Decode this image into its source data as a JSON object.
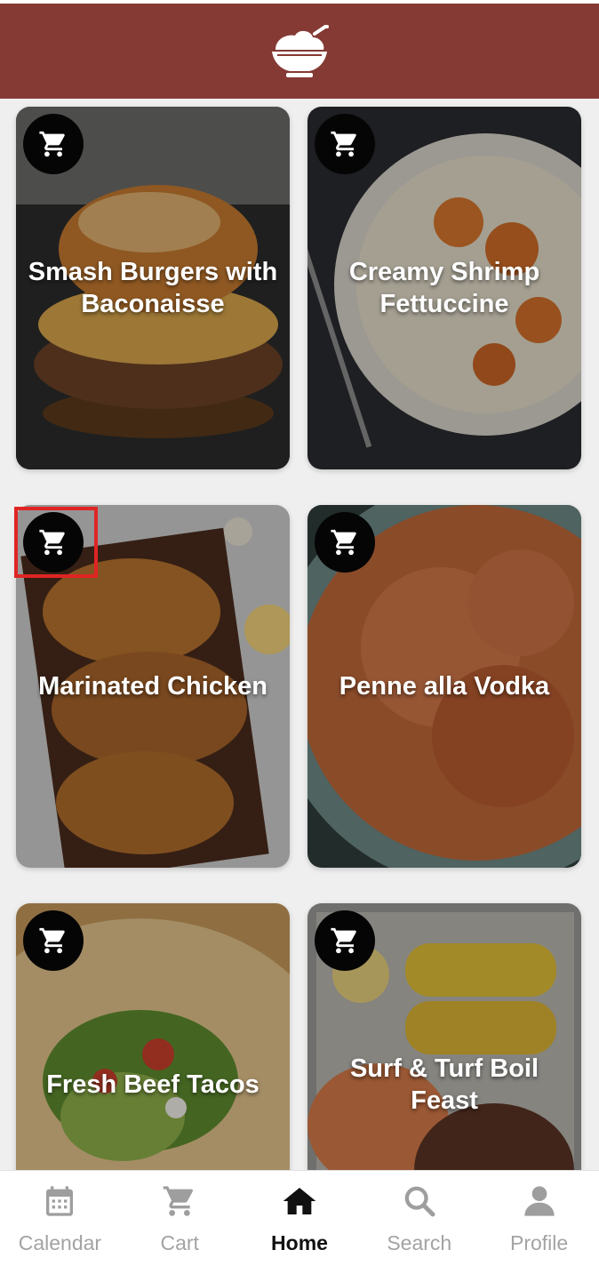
{
  "app": {
    "brand_color": "#853a34",
    "logo_icon": "rice-bowl-icon"
  },
  "recipes": [
    {
      "title": "Smash Burgers with Baconaisse",
      "cart_icon": "cart-icon"
    },
    {
      "title": "Creamy Shrimp Fettuccine",
      "cart_icon": "cart-icon"
    },
    {
      "title": "Marinated Chicken",
      "cart_icon": "cart-icon"
    },
    {
      "title": "Penne alla Vodka",
      "cart_icon": "cart-icon"
    },
    {
      "title": "Fresh Beef Tacos",
      "cart_icon": "cart-icon"
    },
    {
      "title": "Surf & Turf Boil Feast",
      "cart_icon": "cart-icon"
    }
  ],
  "nav": {
    "items": [
      {
        "label": "Calendar",
        "icon": "calendar-icon"
      },
      {
        "label": "Cart",
        "icon": "cart-icon"
      },
      {
        "label": "Home",
        "icon": "home-icon",
        "active": true
      },
      {
        "label": "Search",
        "icon": "search-icon"
      },
      {
        "label": "Profile",
        "icon": "profile-icon"
      }
    ]
  }
}
